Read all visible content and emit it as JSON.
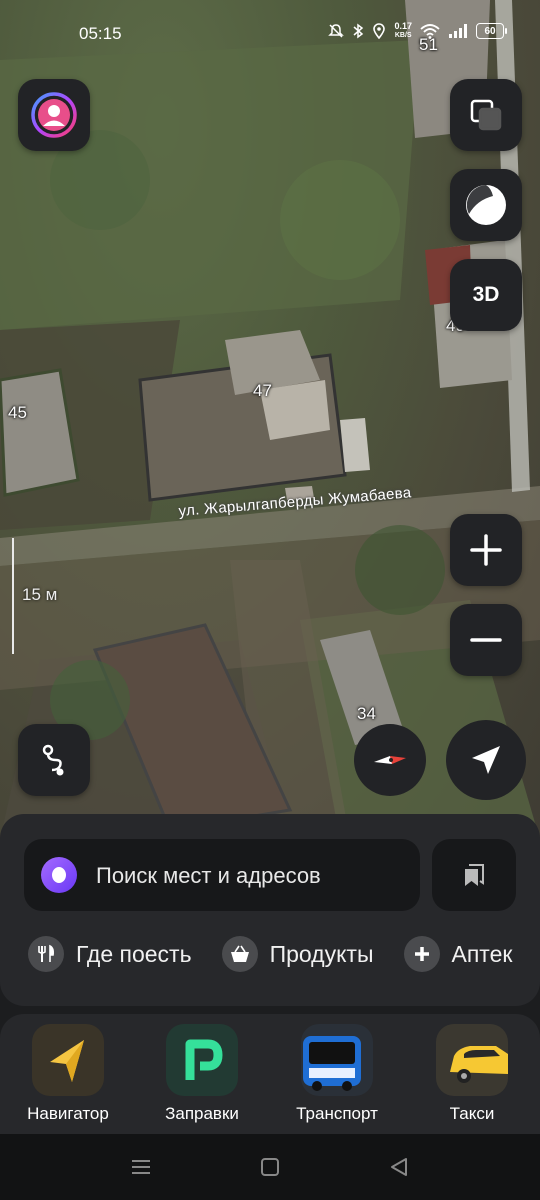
{
  "status_bar": {
    "time": "05:15",
    "net_speed_value": "0.17",
    "net_speed_unit": "KB/S",
    "battery": "60",
    "icons": [
      "mute-icon",
      "bluetooth-icon",
      "location-icon",
      "wifi-icon",
      "signal-icon",
      "battery-icon"
    ]
  },
  "map": {
    "house_numbers": [
      "51",
      "49",
      "47",
      "45",
      "34"
    ],
    "street_name": "ул. Жарылгапберды Жумабаева",
    "scale_label": "15 м",
    "layers_button_label": "3D"
  },
  "search": {
    "placeholder": "Поиск мест и адресов"
  },
  "categories": [
    {
      "label": "Где поесть",
      "icon": "fork-knife-icon"
    },
    {
      "label": "Продукты",
      "icon": "basket-icon"
    },
    {
      "label": "Аптек",
      "icon": "plus-icon"
    }
  ],
  "apps": [
    {
      "label": "Навигатор",
      "icon": "navigator-arrow-icon"
    },
    {
      "label": "Заправки",
      "icon": "fuel-p-icon"
    },
    {
      "label": "Транспорт",
      "icon": "bus-icon"
    },
    {
      "label": "Такси",
      "icon": "taxi-car-icon"
    }
  ],
  "colors": {
    "panel": "#27282b",
    "button": "#222326",
    "accent_purple": "#7b48f7",
    "compass_red": "#e8423a"
  }
}
